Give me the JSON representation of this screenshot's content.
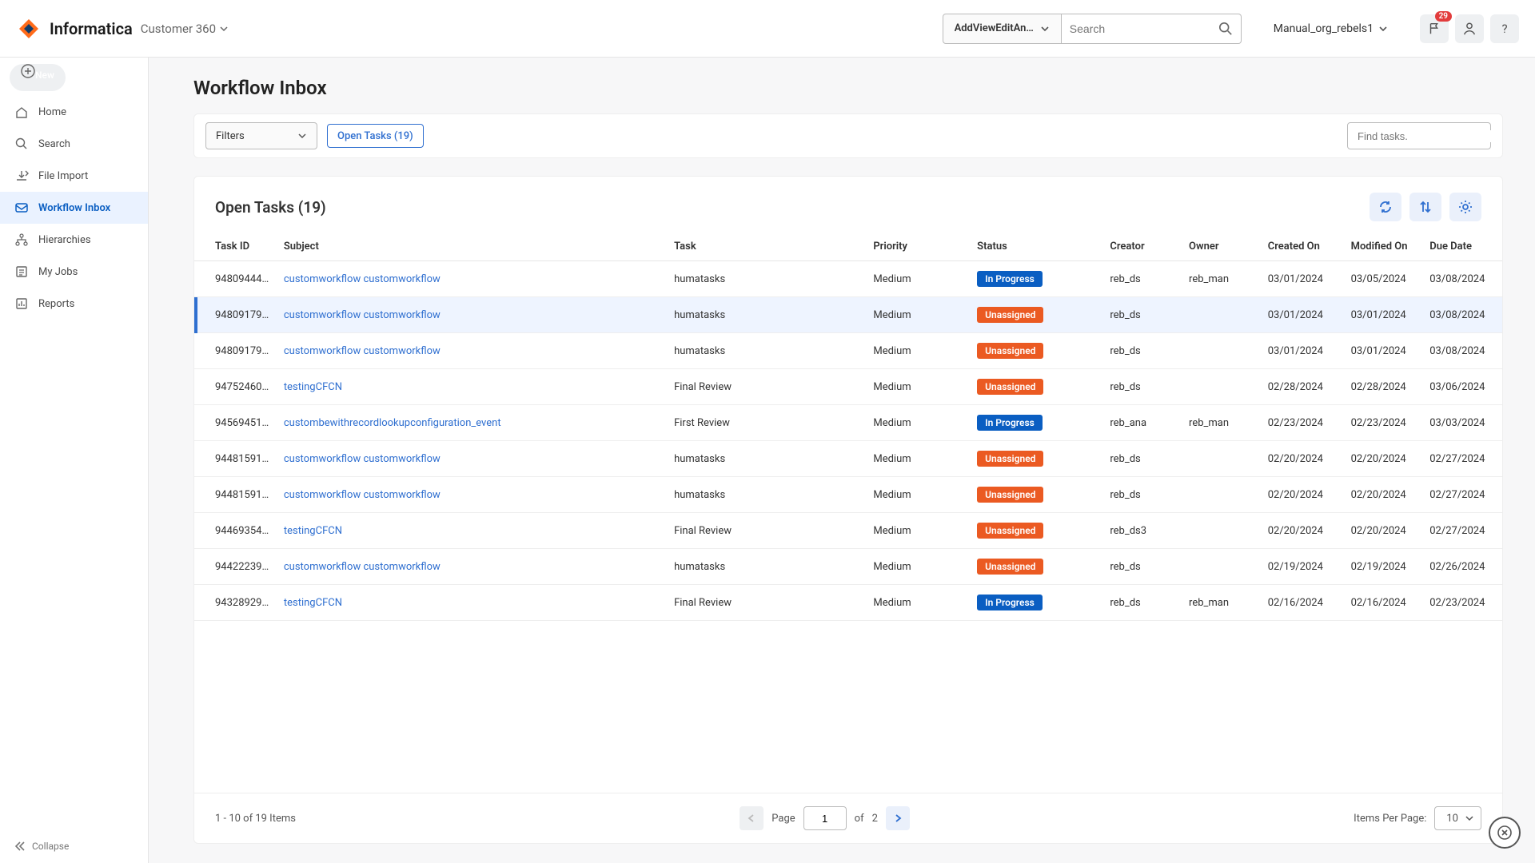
{
  "header": {
    "brand": "Informatica",
    "app_name": "Customer 360",
    "role_label": "AddViewEditAn…",
    "search_placeholder": "Search",
    "user_label": "Manual_org_rebels1",
    "notif_count": "29"
  },
  "sidebar": {
    "items": [
      {
        "label": "New",
        "icon": "plus",
        "pill": true
      },
      {
        "label": "Home",
        "icon": "home"
      },
      {
        "label": "Search",
        "icon": "search"
      },
      {
        "label": "File Import",
        "icon": "import"
      },
      {
        "label": "Workflow Inbox",
        "icon": "inbox",
        "active": true
      },
      {
        "label": "Hierarchies",
        "icon": "hierarchy"
      },
      {
        "label": "My Jobs",
        "icon": "jobs"
      },
      {
        "label": "Reports",
        "icon": "reports"
      }
    ],
    "collapse": "Collapse"
  },
  "page": {
    "title": "Workflow Inbox",
    "filters_label": "Filters",
    "chip_label": "Open Tasks (19)",
    "find_placeholder": "Find tasks.",
    "card_title": "Open Tasks (19)"
  },
  "table": {
    "columns": [
      "Task ID",
      "Subject",
      "Task",
      "Priority",
      "Status",
      "Creator",
      "Owner",
      "Created On",
      "Modified On",
      "Due Date"
    ],
    "rows": [
      {
        "taskid": "94809444…",
        "subject": "customworkflow customworkflow",
        "task": "humatasks",
        "priority": "Medium",
        "status": "In Progress",
        "status_kind": "progress",
        "creator": "reb_ds",
        "owner": "reb_man",
        "created": "03/01/2024",
        "modified": "03/05/2024",
        "due": "03/08/2024"
      },
      {
        "taskid": "94809179…",
        "subject": "customworkflow customworkflow",
        "task": "humatasks",
        "priority": "Medium",
        "status": "Unassigned",
        "status_kind": "unassigned",
        "creator": "reb_ds",
        "owner": "",
        "created": "03/01/2024",
        "modified": "03/01/2024",
        "due": "03/08/2024",
        "selected": true
      },
      {
        "taskid": "94809179…",
        "subject": "customworkflow customworkflow",
        "task": "humatasks",
        "priority": "Medium",
        "status": "Unassigned",
        "status_kind": "unassigned",
        "creator": "reb_ds",
        "owner": "",
        "created": "03/01/2024",
        "modified": "03/01/2024",
        "due": "03/08/2024"
      },
      {
        "taskid": "94752460…",
        "subject": "testingCFCN",
        "task": "Final Review",
        "priority": "Medium",
        "status": "Unassigned",
        "status_kind": "unassigned",
        "creator": "reb_ds",
        "owner": "",
        "created": "02/28/2024",
        "modified": "02/28/2024",
        "due": "03/06/2024"
      },
      {
        "taskid": "94569451…",
        "subject": "custombewithrecordlookupconfiguration_event",
        "task": "First Review",
        "priority": "Medium",
        "status": "In Progress",
        "status_kind": "progress",
        "creator": "reb_ana",
        "owner": "reb_man",
        "created": "02/23/2024",
        "modified": "02/23/2024",
        "due": "03/03/2024"
      },
      {
        "taskid": "94481591…",
        "subject": "customworkflow customworkflow",
        "task": "humatasks",
        "priority": "Medium",
        "status": "Unassigned",
        "status_kind": "unassigned",
        "creator": "reb_ds",
        "owner": "",
        "created": "02/20/2024",
        "modified": "02/20/2024",
        "due": "02/27/2024"
      },
      {
        "taskid": "94481591…",
        "subject": "customworkflow customworkflow",
        "task": "humatasks",
        "priority": "Medium",
        "status": "Unassigned",
        "status_kind": "unassigned",
        "creator": "reb_ds",
        "owner": "",
        "created": "02/20/2024",
        "modified": "02/20/2024",
        "due": "02/27/2024"
      },
      {
        "taskid": "94469354…",
        "subject": "testingCFCN",
        "task": "Final Review",
        "priority": "Medium",
        "status": "Unassigned",
        "status_kind": "unassigned",
        "creator": "reb_ds3",
        "owner": "",
        "created": "02/20/2024",
        "modified": "02/20/2024",
        "due": "02/27/2024"
      },
      {
        "taskid": "94422239…",
        "subject": "customworkflow customworkflow",
        "task": "humatasks",
        "priority": "Medium",
        "status": "Unassigned",
        "status_kind": "unassigned",
        "creator": "reb_ds",
        "owner": "",
        "created": "02/19/2024",
        "modified": "02/19/2024",
        "due": "02/26/2024"
      },
      {
        "taskid": "94328929…",
        "subject": "testingCFCN",
        "task": "Final Review",
        "priority": "Medium",
        "status": "In Progress",
        "status_kind": "progress",
        "creator": "reb_ds",
        "owner": "reb_man",
        "created": "02/16/2024",
        "modified": "02/16/2024",
        "due": "02/23/2024"
      }
    ]
  },
  "pagination": {
    "range_label": "1 - 10 of 19 Items",
    "page_label": "Page",
    "current_page": "1",
    "of_label": "of",
    "total_pages": "2",
    "ipp_label": "Items Per Page:",
    "ipp_value": "10"
  }
}
